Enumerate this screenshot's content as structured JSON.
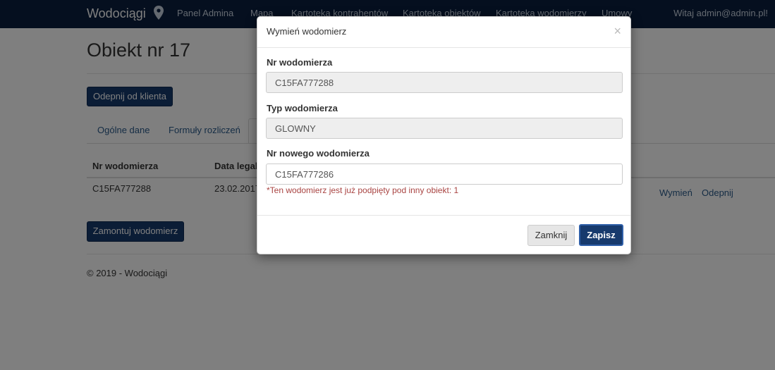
{
  "navbar": {
    "brand": "Wodociągi",
    "links": [
      "Panel Admina",
      "Mapa",
      "Kartoteka kontrahentów",
      "Kartoteka obiektów",
      "Kartoteka wodomierzy",
      "Umowy"
    ],
    "user_greeting": "Witaj admin@admin.pl!"
  },
  "page": {
    "title": "Obiekt nr 17",
    "detach_client_button": "Odepnij od klienta",
    "tabs": [
      "Ogólne dane",
      "Formuły rozliczeń"
    ],
    "table": {
      "headers": [
        "Nr wodomierza",
        "Data legal"
      ],
      "rows": [
        {
          "meter_number": "C15FA777288",
          "date": "23.02.2017",
          "actions": [
            "Wymień",
            "Odepnij"
          ]
        }
      ]
    },
    "mount_meter_button": "Zamontuj wodomierz",
    "footer": "© 2019 - Wodociągi"
  },
  "modal": {
    "title": "Wymień wodomierz",
    "close_symbol": "×",
    "fields": {
      "meter_number_label": "Nr wodomierza",
      "meter_number_value": "C15FA777288",
      "meter_type_label": "Typ wodomierza",
      "meter_type_value": "GLOWNY",
      "new_meter_label": "Nr nowego wodomierza",
      "new_meter_value": "C15FA777286"
    },
    "error": "*Ten wodomierz jest już podpięty pod inny obiekt: 1",
    "close_button": "Zamknij",
    "save_button": "Zapisz"
  },
  "colors": {
    "navbar_bg": "#0a1f3f",
    "primary": "#173a6d",
    "error": "#a94442"
  }
}
